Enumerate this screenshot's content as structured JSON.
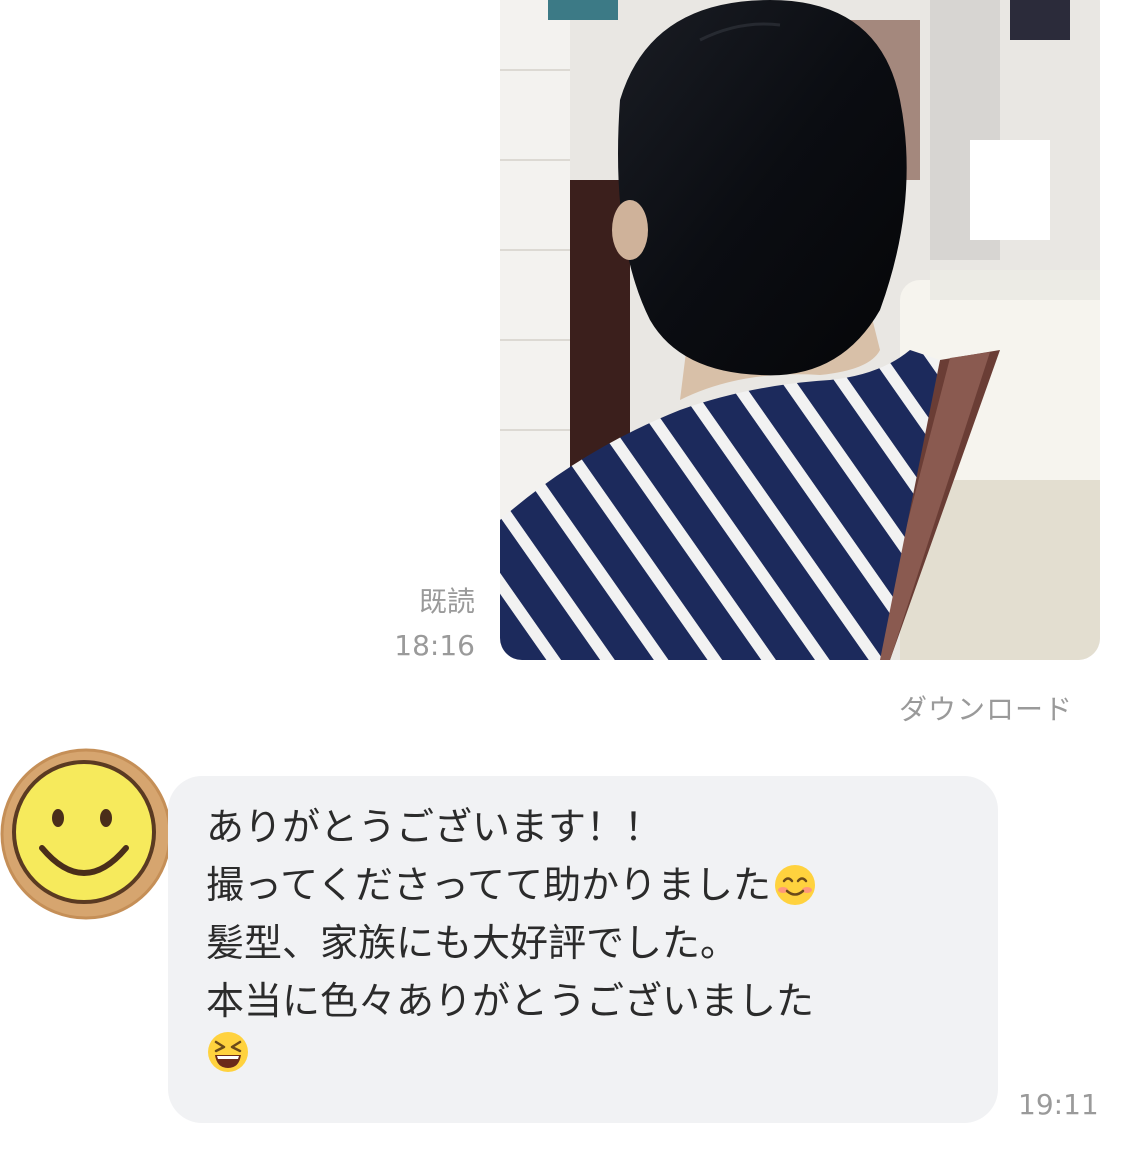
{
  "sent_message": {
    "attachment": "photo-hair-back-view",
    "read_status": "既読",
    "time": "18:16",
    "download_label": "ダウンロード"
  },
  "received_message": {
    "avatar": "smiley-face",
    "lines": [
      "ありがとうございます！！",
      "撮ってくださってて助かりました",
      "髪型、家族にも大好評でした。",
      "本当に色々ありがとうございました"
    ],
    "emojis": [
      "smiling-face-emoji",
      "grinning-squinting-face-emoji"
    ],
    "time": "19:11"
  },
  "colors": {
    "bubble_bg": "#f1f2f4",
    "meta_text": "#9a9a9a",
    "message_text": "#2b2b2b"
  }
}
